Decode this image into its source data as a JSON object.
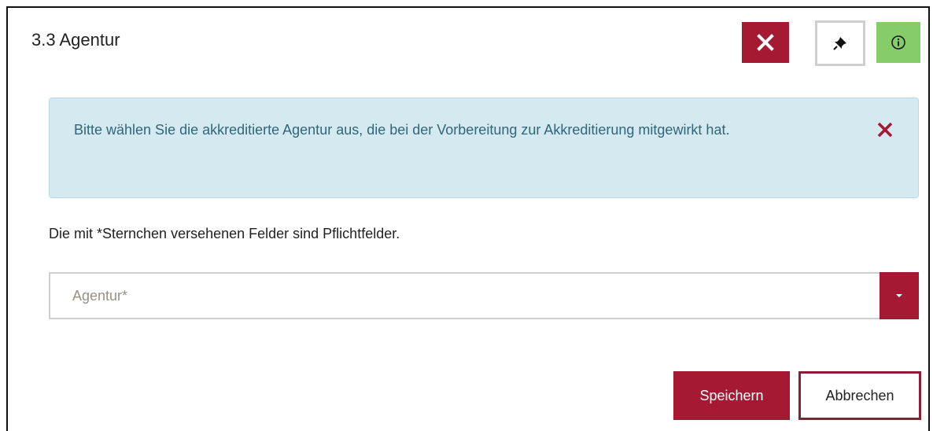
{
  "dialog": {
    "title": "3.3 Agentur",
    "header_buttons": {
      "close_icon": "close-icon",
      "pin_icon": "pin-icon",
      "info_icon": "info-icon"
    }
  },
  "alert": {
    "text": "Bitte wählen Sie die akkreditierte Agentur aus, die bei der Vorbereitung zur Akkreditierung mitgewirkt hat.",
    "close_icon": "close-icon"
  },
  "form": {
    "required_note": "Die mit *Sternchen versehenen Felder sind Pflichtfelder.",
    "agentur_select": {
      "placeholder": "Agentur*",
      "value": ""
    }
  },
  "actions": {
    "save_label": "Speichern",
    "cancel_label": "Abbrechen"
  },
  "colors": {
    "primary": "#a51932",
    "info_green": "#86cc6b",
    "alert_bg": "#d4eaf0",
    "alert_text": "#31667a"
  }
}
